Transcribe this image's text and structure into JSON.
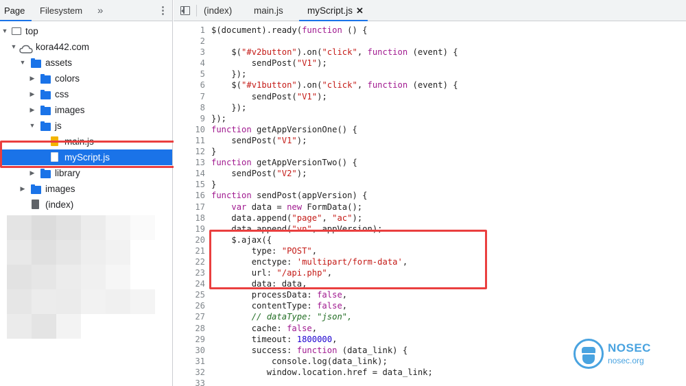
{
  "left_panel": {
    "tabs": [
      {
        "label": "Page",
        "active": true
      },
      {
        "label": "Filesystem",
        "active": false
      }
    ],
    "more_tabs_glyph": "»",
    "menu_glyph": "⋮",
    "tree": [
      {
        "label": "top",
        "icon": "frame-icon",
        "expanded": true
      },
      {
        "label": "kora442.com",
        "icon": "cloud-icon",
        "expanded": true
      },
      {
        "label": "assets",
        "icon": "folder-icon",
        "expanded": true
      },
      {
        "label": "colors",
        "icon": "folder-icon",
        "expanded": false
      },
      {
        "label": "css",
        "icon": "folder-icon",
        "expanded": false
      },
      {
        "label": "images",
        "icon": "folder-icon",
        "expanded": false
      },
      {
        "label": "js",
        "icon": "folder-icon",
        "expanded": true
      },
      {
        "label": "main.js",
        "icon": "js-file-icon"
      },
      {
        "label": "myScript.js",
        "icon": "file-icon",
        "selected": true
      },
      {
        "label": "library",
        "icon": "folder-icon",
        "expanded": false
      },
      {
        "label": "images",
        "icon": "folder-icon",
        "expanded": false
      },
      {
        "label": "(index)",
        "icon": "document-icon"
      }
    ]
  },
  "editor": {
    "tabs": [
      {
        "label": "(index)",
        "active": false
      },
      {
        "label": "main.js",
        "active": false
      },
      {
        "label": "myScript.js",
        "active": true
      }
    ],
    "close_glyph": "✕",
    "lines": [
      {
        "n": "1",
        "text": "$(document).ready(function () {"
      },
      {
        "n": "2",
        "text": ""
      },
      {
        "n": "3",
        "text": "    $(\"#v2button\").on(\"click\", function (event) {"
      },
      {
        "n": "4",
        "text": "        sendPost(\"V1\");"
      },
      {
        "n": "5",
        "text": "    });"
      },
      {
        "n": "6",
        "text": "    $(\"#v1button\").on(\"click\", function (event) {"
      },
      {
        "n": "7",
        "text": "        sendPost(\"V1\");"
      },
      {
        "n": "8",
        "text": "    });"
      },
      {
        "n": "9",
        "text": "});"
      },
      {
        "n": "10",
        "text": "function getAppVersionOne() {"
      },
      {
        "n": "11",
        "text": "    sendPost(\"V1\");"
      },
      {
        "n": "12",
        "text": "}"
      },
      {
        "n": "13",
        "text": "function getAppVersionTwo() {"
      },
      {
        "n": "14",
        "text": "    sendPost(\"V2\");"
      },
      {
        "n": "15",
        "text": "}"
      },
      {
        "n": "16",
        "text": "function sendPost(appVersion) {"
      },
      {
        "n": "17",
        "text": "    var data = new FormData();"
      },
      {
        "n": "18",
        "text": "    data.append(\"page\", \"ac\");"
      },
      {
        "n": "19",
        "text": "    data.append(\"vn\", appVersion);"
      },
      {
        "n": "20",
        "text": "    $.ajax({"
      },
      {
        "n": "21",
        "text": "        type: \"POST\","
      },
      {
        "n": "22",
        "text": "        enctype: 'multipart/form-data',"
      },
      {
        "n": "23",
        "text": "        url: \"/api.php\","
      },
      {
        "n": "24",
        "text": "        data: data,"
      },
      {
        "n": "25",
        "text": "        processData: false,"
      },
      {
        "n": "26",
        "text": "        contentType: false,"
      },
      {
        "n": "27",
        "text": "        // dataType: \"json\","
      },
      {
        "n": "28",
        "text": "        cache: false,"
      },
      {
        "n": "29",
        "text": "        timeout: 1800000,"
      },
      {
        "n": "30",
        "text": "        success: function (data_link) {"
      },
      {
        "n": "31",
        "text": "            console.log(data_link);"
      },
      {
        "n": "32",
        "text": "           window.location.href = data_link;"
      },
      {
        "n": "33",
        "text": ""
      }
    ]
  },
  "watermark": {
    "title": "NOSEC",
    "subtitle": "nosec.org",
    "color": "#49a3e0"
  },
  "colors": {
    "accent": "#1a73e8",
    "highlight_box": "#ea3f3f"
  }
}
